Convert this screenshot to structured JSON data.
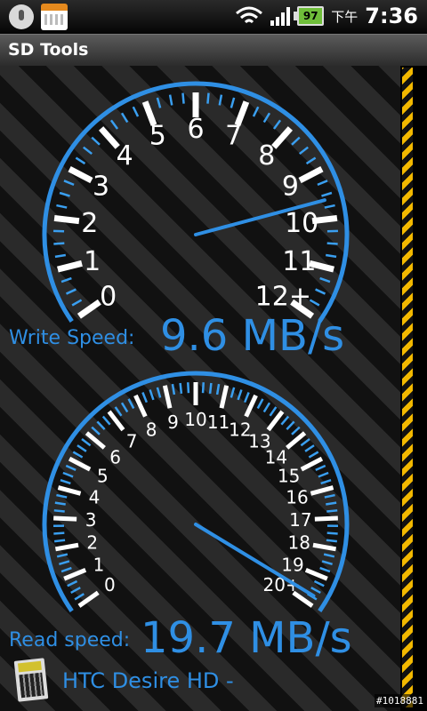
{
  "status_bar": {
    "battery": "97",
    "ampm": "下午",
    "time": "7:36"
  },
  "app": {
    "title": "SD Tools"
  },
  "write_gauge": {
    "labels": [
      "0",
      "1",
      "2",
      "3",
      "4",
      "5",
      "6",
      "7",
      "8",
      "9",
      "10",
      "11",
      "12+"
    ],
    "needle_value": 9.6,
    "max_value": 12,
    "caption": "Write Speed:",
    "value_text": "9.6 MB/s"
  },
  "read_gauge": {
    "labels": [
      "0",
      "1",
      "2",
      "3",
      "4",
      "5",
      "6",
      "7",
      "8",
      "9",
      "10",
      "11",
      "12",
      "13",
      "14",
      "15",
      "16",
      "17",
      "18",
      "19",
      "20+"
    ],
    "needle_value": 19.7,
    "max_value": 20,
    "caption": "Read speed:",
    "value_text": "19.7 MB/s"
  },
  "footer": {
    "device": "HTC Desire HD -"
  },
  "watermark": "#1018881",
  "colors": {
    "accent": "#2f8fe4",
    "background_dark": "#111111",
    "background_light": "#2a2a2a",
    "stripe": "#f2b800"
  }
}
